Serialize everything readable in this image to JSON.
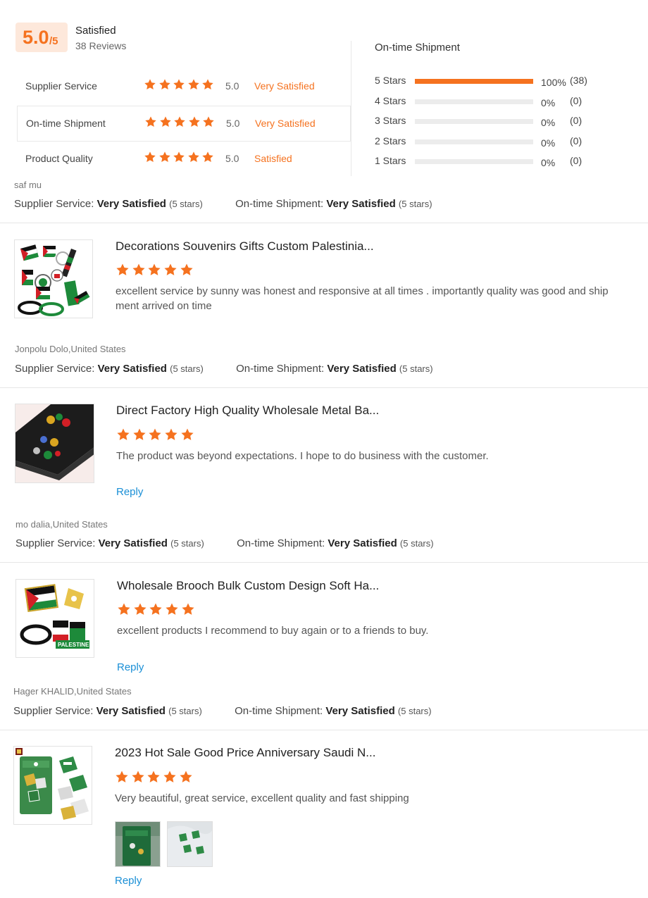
{
  "summary": {
    "score": "5.0",
    "score_max": "/5",
    "satisfaction": "Satisfied",
    "reviews_count": "38 Reviews",
    "ratings": [
      {
        "label": "Supplier Service",
        "score": "5.0",
        "stars": 5,
        "satisfaction": "Very Satisfied"
      },
      {
        "label": "On-time Shipment",
        "score": "5.0",
        "stars": 5,
        "satisfaction": "Very Satisfied"
      },
      {
        "label": "Product Quality",
        "score": "5.0",
        "stars": 5,
        "satisfaction": "Satisfied"
      }
    ],
    "shipment": {
      "title": "On-time Shipment",
      "rows": [
        {
          "label": "5 Stars",
          "fraction": 1.0,
          "percent": "100%",
          "count": "(38)"
        },
        {
          "label": "4 Stars",
          "fraction": 0,
          "percent": "0%",
          "count": "(0)"
        },
        {
          "label": "3 Stars",
          "fraction": 0,
          "percent": "0%",
          "count": "(0)"
        },
        {
          "label": "2 Stars",
          "fraction": 0,
          "percent": "0%",
          "count": "(0)"
        },
        {
          "label": "1 Stars",
          "fraction": 0,
          "percent": "0%",
          "count": "(0)"
        }
      ]
    }
  },
  "labels": {
    "supplier_service": "Supplier Service:",
    "ontime_shipment": "On-time Shipment:",
    "very_satisfied": "Very Satisfied",
    "five_stars": "(5 stars)",
    "reply": "Reply"
  },
  "reviews": [
    {
      "reviewer": "saf mu",
      "product_title": "Decorations Souvenirs Gifts Custom Palestinia...",
      "stars": 5,
      "comment": "excellent service by sunny was honest and responsive at all times . importantly quality was good and ship ment arrived on time"
    },
    {
      "reviewer": "Jonpolu Dolo,United States",
      "product_title": "Direct Factory High Quality Wholesale Metal Ba...",
      "stars": 5,
      "comment": "The product was beyond expectations.  I hope to do business with the customer."
    },
    {
      "reviewer": "mo dalia,United States",
      "product_title": "Wholesale Brooch Bulk Custom Design Soft Ha...",
      "stars": 5,
      "comment": "excellent products I recommend to buy again or to a friends to buy."
    },
    {
      "reviewer": "Hager KHALID,United States",
      "product_title": "2023 Hot Sale Good Price Anniversary Saudi N...",
      "stars": 5,
      "comment": "Very beautiful, great service, excellent quality and fast shipping"
    }
  ],
  "colors": {
    "accent": "#f5721f",
    "link": "#1a8fd6",
    "score_bg": "#fde8db"
  }
}
